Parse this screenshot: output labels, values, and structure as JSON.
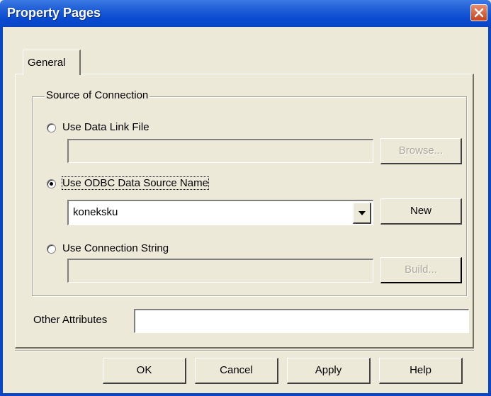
{
  "window": {
    "title": "Property Pages"
  },
  "tabs": [
    {
      "label": "General"
    }
  ],
  "group": {
    "legend": "Source of Connection",
    "options": [
      {
        "label": "Use Data Link File",
        "selected": false
      },
      {
        "label": "Use ODBC Data Source Name",
        "selected": true
      },
      {
        "label": "Use Connection String",
        "selected": false
      }
    ],
    "data_link_value": "",
    "dsn_value": "koneksku",
    "connection_string_value": "",
    "browse_label": "Browse...",
    "new_label": "New",
    "build_label": "Build..."
  },
  "other_attributes": {
    "label": "Other Attributes",
    "value": ""
  },
  "footer": {
    "ok_label": "OK",
    "cancel_label": "Cancel",
    "apply_label": "Apply",
    "help_label": "Help"
  }
}
